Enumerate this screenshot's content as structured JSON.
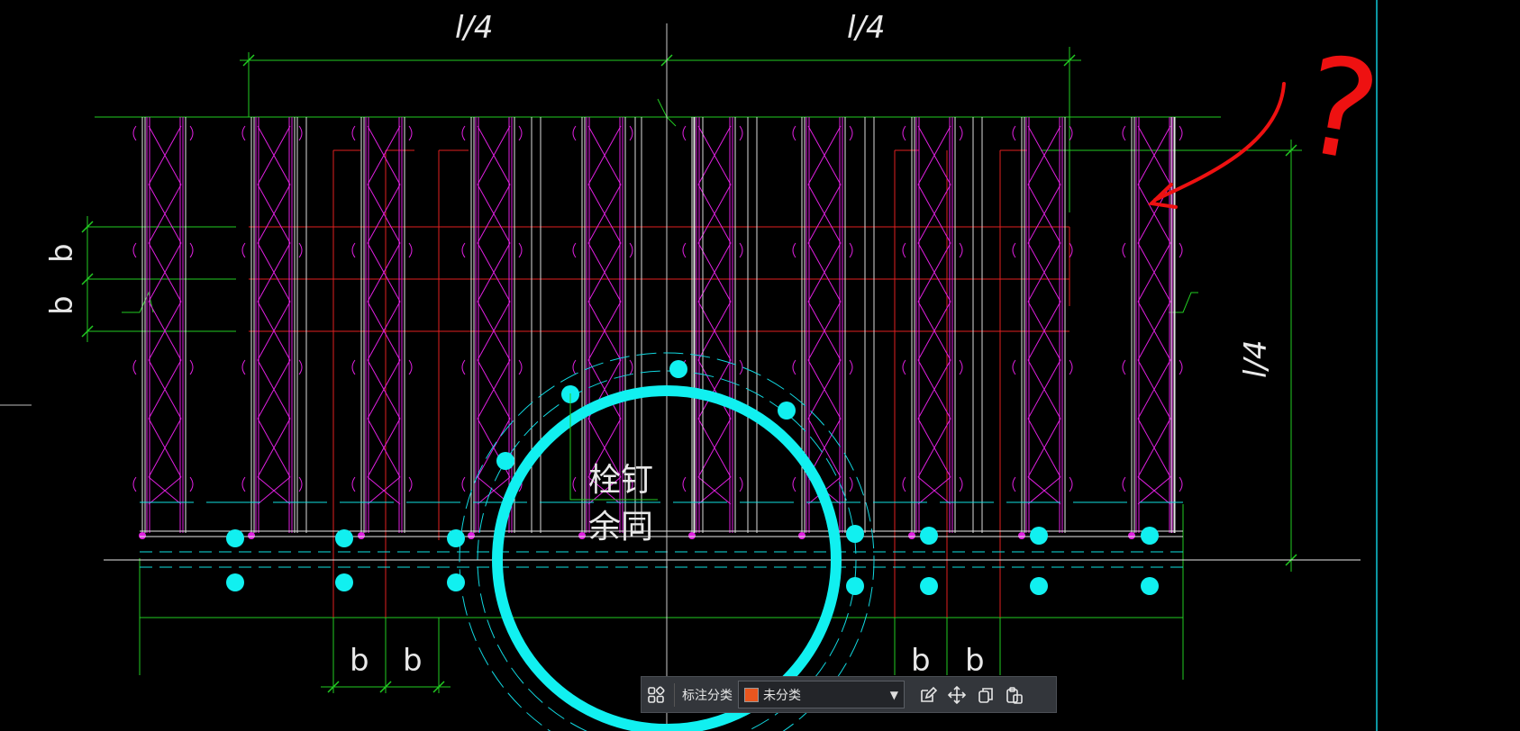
{
  "drawing": {
    "dimension_labels": {
      "top_left": "l/4",
      "top_right": "l/4",
      "right": "l/4",
      "left_upper": "b",
      "left_lower": "b",
      "bottom_left_1": "b",
      "bottom_left_2": "b",
      "bottom_right_1": "b",
      "bottom_right_2": "b"
    },
    "note_line1": "栓钉",
    "note_line2": "余同",
    "markup": "?"
  },
  "toolbar": {
    "label": "标注分类",
    "category_value": "未分类",
    "category_color": "#e8561f",
    "icons": [
      "layout-grid-icon",
      "edit-icon",
      "move-icon",
      "copy-icon",
      "paste-icon"
    ]
  },
  "colors": {
    "background": "#000000",
    "magenta": "#e020e0",
    "green": "#22cc22",
    "cyan": "#11f0f0",
    "red": "#e02020",
    "white": "#e8e8e8",
    "annotation_red": "#ee1111"
  }
}
